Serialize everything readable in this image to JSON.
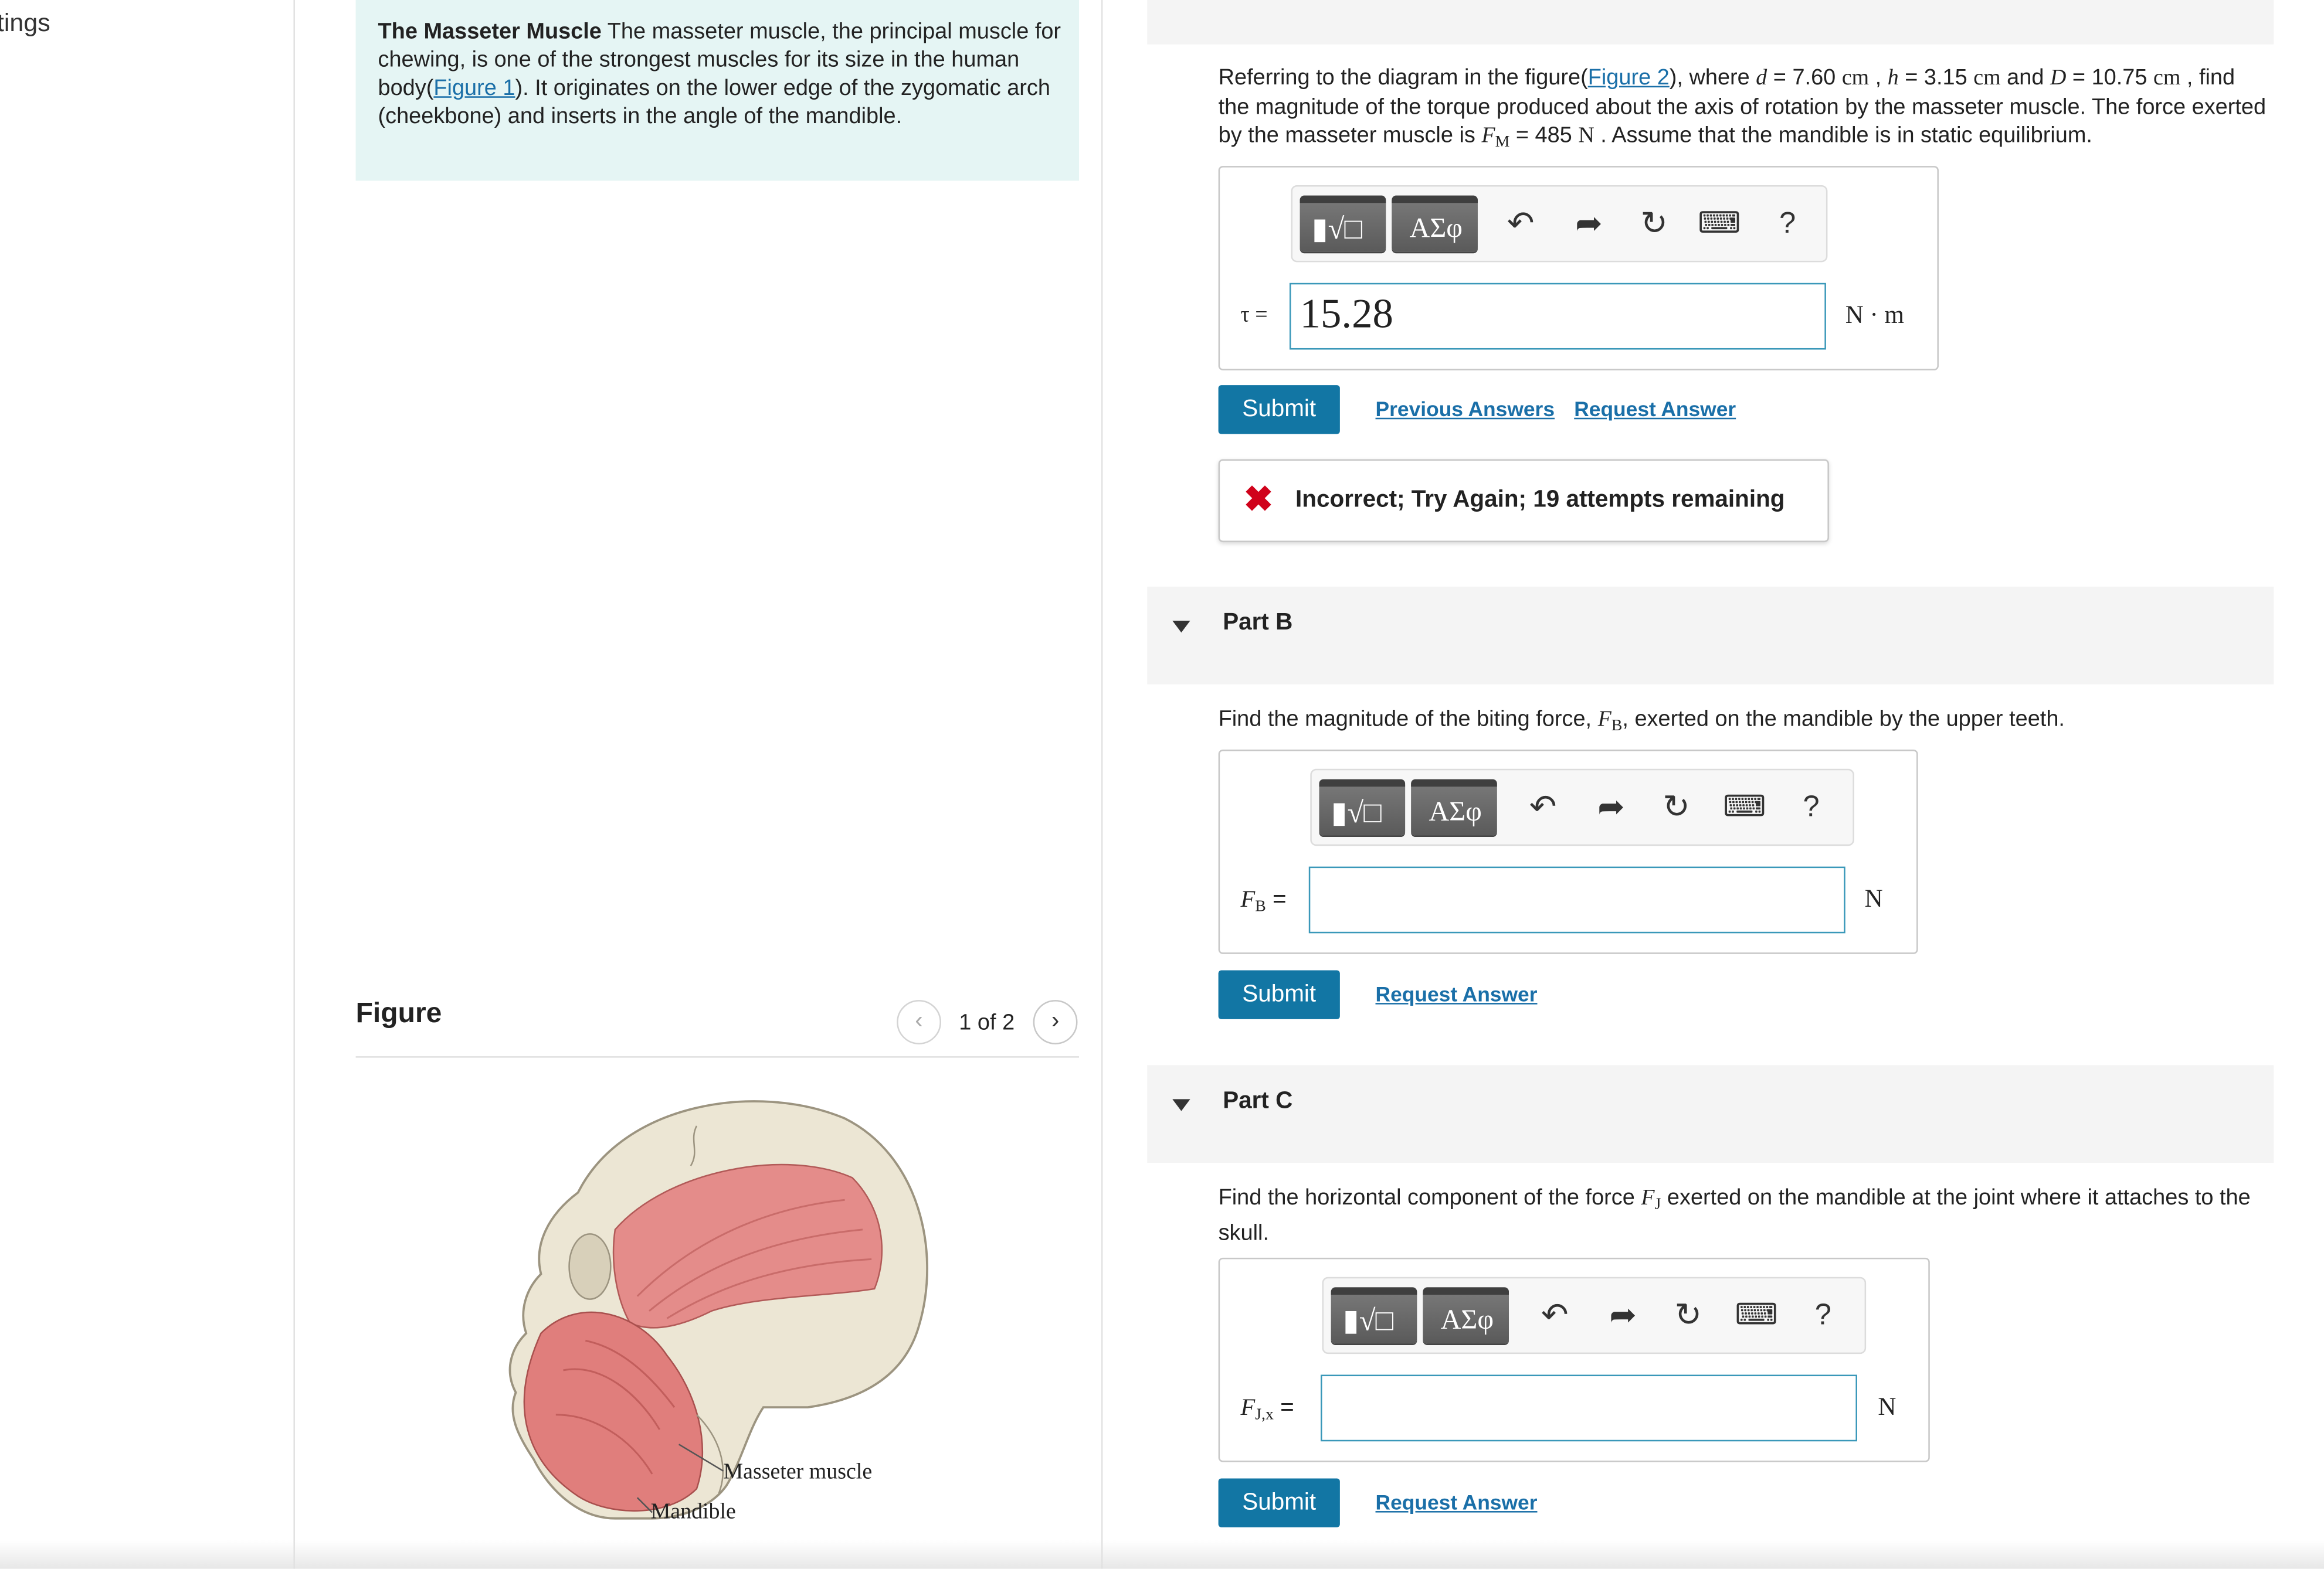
{
  "left_nav": {
    "partial_label": "tings"
  },
  "intro": {
    "title": "The Masseter Muscle",
    "text_1": " The masseter muscle, the principal muscle for chewing, is one of the strongest muscles for its size in the human body(",
    "figure_link": "Figure 1",
    "text_2": "). It originates on the lower edge of the zygomatic arch (cheekbone) and inserts in the angle of the mandible."
  },
  "figure": {
    "heading": "Figure",
    "pager": "1 of 2",
    "labels": {
      "masseter": "Masseter muscle",
      "mandible": "Mandible"
    }
  },
  "part_a": {
    "q1": "Referring to the diagram in the figure(",
    "figure_link": "Figure 2",
    "q2": "), where ",
    "d_sym": "d",
    "d_val": " = 7.60 ",
    "d_unit": "cm",
    "sep1": " , ",
    "h_sym": "h",
    "h_val": " = 3.15 ",
    "h_unit": "cm",
    "and": " and ",
    "D_sym": "D",
    "D_val": " = 10.75 ",
    "D_unit": "cm",
    "q3": " , find the magnitude of the torque produced about the axis of rotation by the masseter muscle. The force exerted by the masseter muscle is ",
    "F_sym": "F",
    "F_sub": "M",
    "F_val": " = 485 ",
    "F_unit": "N",
    "q4": " . Assume that the mandible is in static equilibrium.",
    "input_label": "τ =",
    "input_value": "15.28",
    "unit": "N · m",
    "submit": "Submit",
    "previous_answers": "Previous Answers",
    "request_answer": "Request Answer",
    "feedback": "Incorrect; Try Again; 19 attempts remaining",
    "feedback_color": "#d0021b"
  },
  "part_b": {
    "title": "Part B",
    "q1": "Find the magnitude of the biting force, ",
    "F_sym": "F",
    "F_sub": "B",
    "q2": ", exerted on the mandible by the upper teeth.",
    "input_label_sym": "F",
    "input_label_sub": "B",
    "eq": " =",
    "input_value": "",
    "unit": "N",
    "submit": "Submit",
    "request_answer": "Request Answer"
  },
  "part_c": {
    "title": "Part C",
    "q1": "Find the horizontal component of the force ",
    "F_sym": "F",
    "F_sub": "J",
    "q2": " exerted on the mandible at the joint where it attaches to the skull.",
    "input_label_sym": "F",
    "input_label_sub": "J,x",
    "eq": " =",
    "input_value": "",
    "unit": "N",
    "submit": "Submit",
    "request_answer": "Request Answer"
  },
  "toolbar": {
    "templates_icon": "templates-icon",
    "symbols_label": "ΑΣφ",
    "undo_icon": "undo-icon",
    "redo_icon": "redo-icon",
    "reset_icon": "reset-icon",
    "keyboard_icon": "keyboard-icon",
    "help_label": "?"
  },
  "colors": {
    "accent": "#1276a4",
    "link": "#1a6fa8",
    "intro_bg": "#e5f5f4",
    "input_border": "#3a98b9"
  }
}
